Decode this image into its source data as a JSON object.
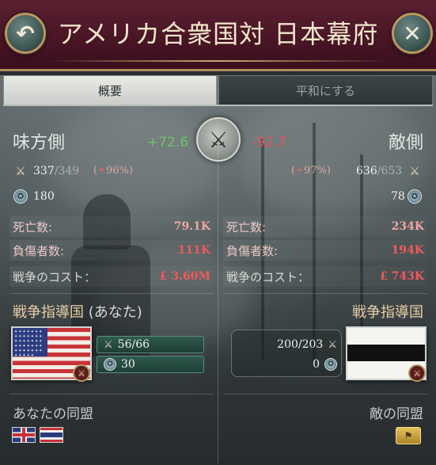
{
  "header": {
    "title": "アメリカ合衆国対 日本幕府",
    "back_icon": "↶",
    "close_icon": "✕"
  },
  "tabs": [
    {
      "label": "概要",
      "active": true
    },
    {
      "label": "平和にする",
      "active": false
    }
  ],
  "score": {
    "ally": "+72.6",
    "enemy": "-92.7"
  },
  "ally": {
    "side_label": "味方側",
    "troops_current": "337",
    "troops_total": "/349",
    "morale_pct": "96%",
    "generals": "180",
    "deaths": {
      "label": "死亡数:",
      "value": "79.1K"
    },
    "wounded": {
      "label": "負傷者数:",
      "value": "111K"
    },
    "cost": {
      "label": "戦争のコスト：",
      "value": "£ 3.60M"
    },
    "leader_title": "戦争指導国",
    "leader_suffix": " (あなた)",
    "leader_troops": "56/66",
    "leader_generals": "30",
    "alliance_title": "あなたの同盟"
  },
  "enemy": {
    "side_label": "敵側",
    "morale_pct": "97%",
    "troops_current": "636",
    "troops_total": "/653",
    "generals": "78",
    "deaths": {
      "label": "死亡数:",
      "value": "234K"
    },
    "wounded": {
      "label": "負傷者数:",
      "value": "194K"
    },
    "cost": {
      "label": "戦争のコスト：",
      "value": "£ 743K"
    },
    "leader_title": "戦争指導国",
    "leader_troops": "200/203",
    "leader_generals": "0",
    "alliance_title": "敵の同盟"
  },
  "colors": {
    "header_bg": "#4a1626",
    "gold_trim": "#b8975f",
    "positive": "#6fc26a",
    "negative": "#e0525a"
  },
  "icons": {
    "troops": "crossed-swords-icon",
    "generals": "medal-icon",
    "morale": "morale-icon",
    "crest": "crest-icon"
  }
}
